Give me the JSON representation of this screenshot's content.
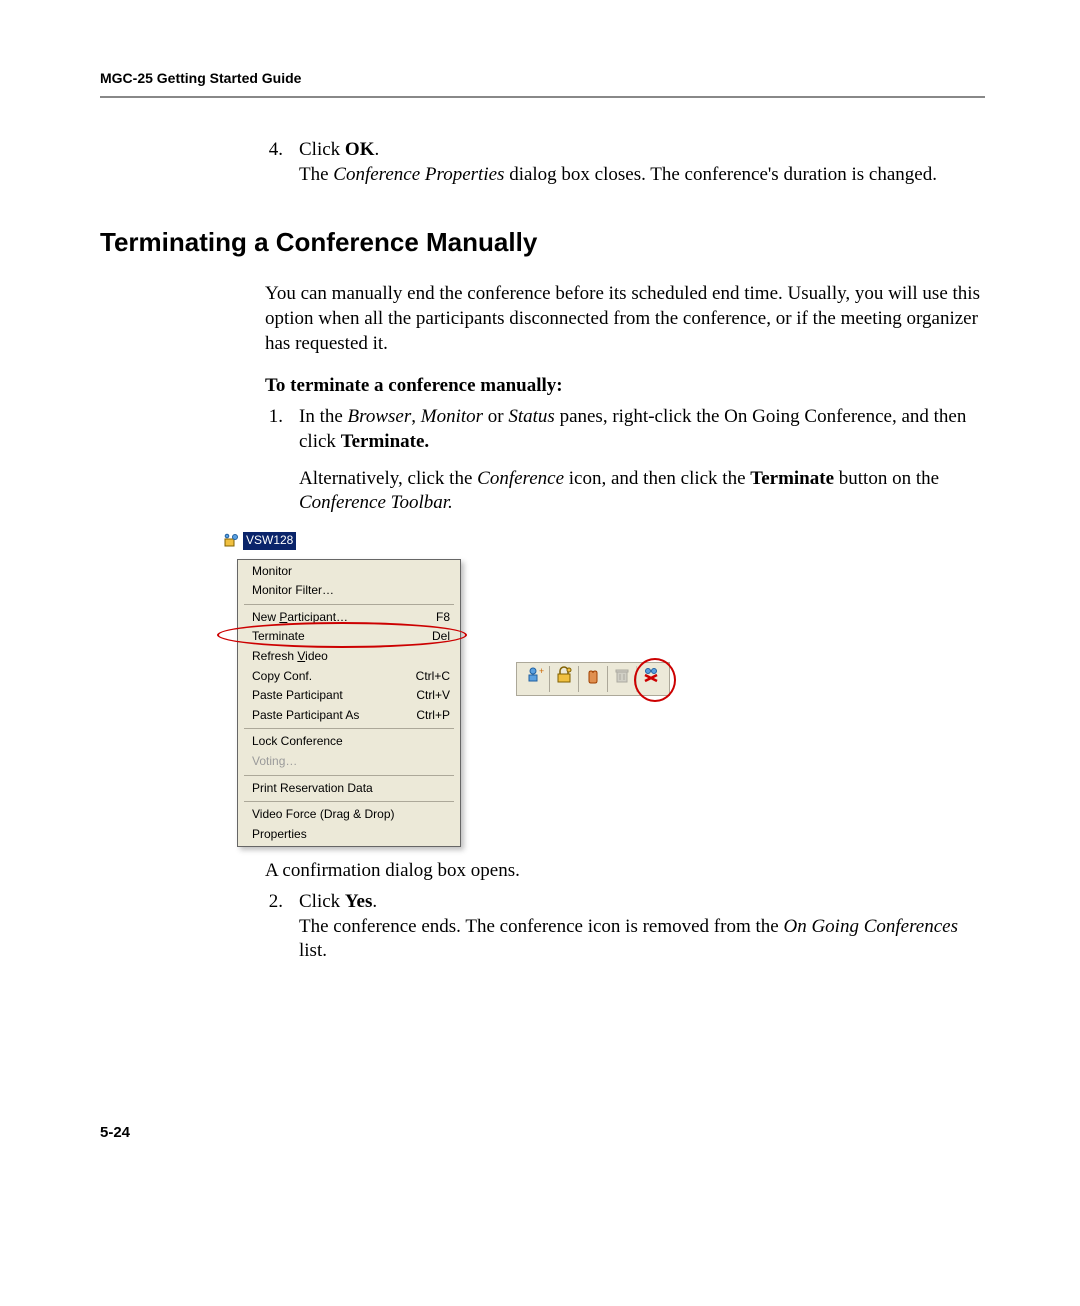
{
  "header": {
    "running_head": "MGC-25 Getting Started Guide"
  },
  "step4": {
    "num": "4.",
    "line1_pre": "Click ",
    "line1_bold": "OK",
    "line1_post": ".",
    "line2_pre": "The ",
    "line2_ital": "Conference Properties",
    "line2_post": " dialog box closes. The conference's duration is changed."
  },
  "section": {
    "heading": "Terminating a Conference Manually",
    "intro": "You can manually end the conference before its scheduled end time. Usually, you will use this option when all the participants disconnected from the conference, or if the meeting organizer has requested it.",
    "lead": "To terminate a conference manually:"
  },
  "step1": {
    "num": "1.",
    "p1_a": "In the ",
    "p1_b": "Browser",
    "p1_c": ", ",
    "p1_d": "Monitor",
    "p1_e": " or ",
    "p1_f": "Status",
    "p1_g": " panes, right-click the On Going Conference, and then click ",
    "p1_h": "Terminate.",
    "p2_a": "Alternatively, click the ",
    "p2_b": "Conference",
    "p2_c": " icon, and then click the ",
    "p2_d": "Terminate",
    "p2_e": " button on the ",
    "p2_f": "Conference Toolbar.",
    "after": "A confirmation dialog box opens."
  },
  "step2": {
    "num": "2.",
    "l1_a": "Click ",
    "l1_b": "Yes",
    "l1_c": ".",
    "l2_a": "The conference ends. The conference icon is removed from the ",
    "l2_b": "On Going Conferences",
    "l2_c": " list."
  },
  "context_menu": {
    "node_label": "VSW128",
    "items": [
      {
        "label": "Monitor",
        "shortcut": "",
        "disabled": false
      },
      {
        "label": "Monitor Filter…",
        "shortcut": "",
        "disabled": false
      },
      {
        "sep": true
      },
      {
        "label": "New Participant…",
        "shortcut": "F8",
        "disabled": false,
        "underline": "P"
      },
      {
        "label": "Terminate",
        "shortcut": "Del",
        "disabled": false,
        "highlight": true
      },
      {
        "label": "Refresh Video",
        "shortcut": "",
        "disabled": false,
        "underline": "V"
      },
      {
        "label": "Copy Conf.",
        "shortcut": "Ctrl+C",
        "disabled": false
      },
      {
        "label": "Paste Participant",
        "shortcut": "Ctrl+V",
        "disabled": false
      },
      {
        "label": "Paste Participant As",
        "shortcut": "Ctrl+P",
        "disabled": false
      },
      {
        "sep": true
      },
      {
        "label": "Lock Conference",
        "shortcut": "",
        "disabled": false
      },
      {
        "label": "Voting…",
        "shortcut": "",
        "disabled": true
      },
      {
        "sep": true
      },
      {
        "label": "Print Reservation Data",
        "shortcut": "",
        "disabled": false
      },
      {
        "sep": true
      },
      {
        "label": "Video Force (Drag & Drop)",
        "shortcut": "",
        "disabled": false
      },
      {
        "label": "Properties",
        "shortcut": "",
        "disabled": false
      }
    ]
  },
  "toolbar": {
    "buttons": [
      {
        "name": "new-participant-icon",
        "disabled": false
      },
      {
        "name": "lock-conference-icon",
        "disabled": false
      },
      {
        "name": "hold-icon",
        "disabled": false
      },
      {
        "name": "delete-icon",
        "disabled": true
      },
      {
        "name": "terminate-icon",
        "disabled": false,
        "highlight": true
      }
    ]
  },
  "footer": {
    "page_number": "5-24"
  }
}
